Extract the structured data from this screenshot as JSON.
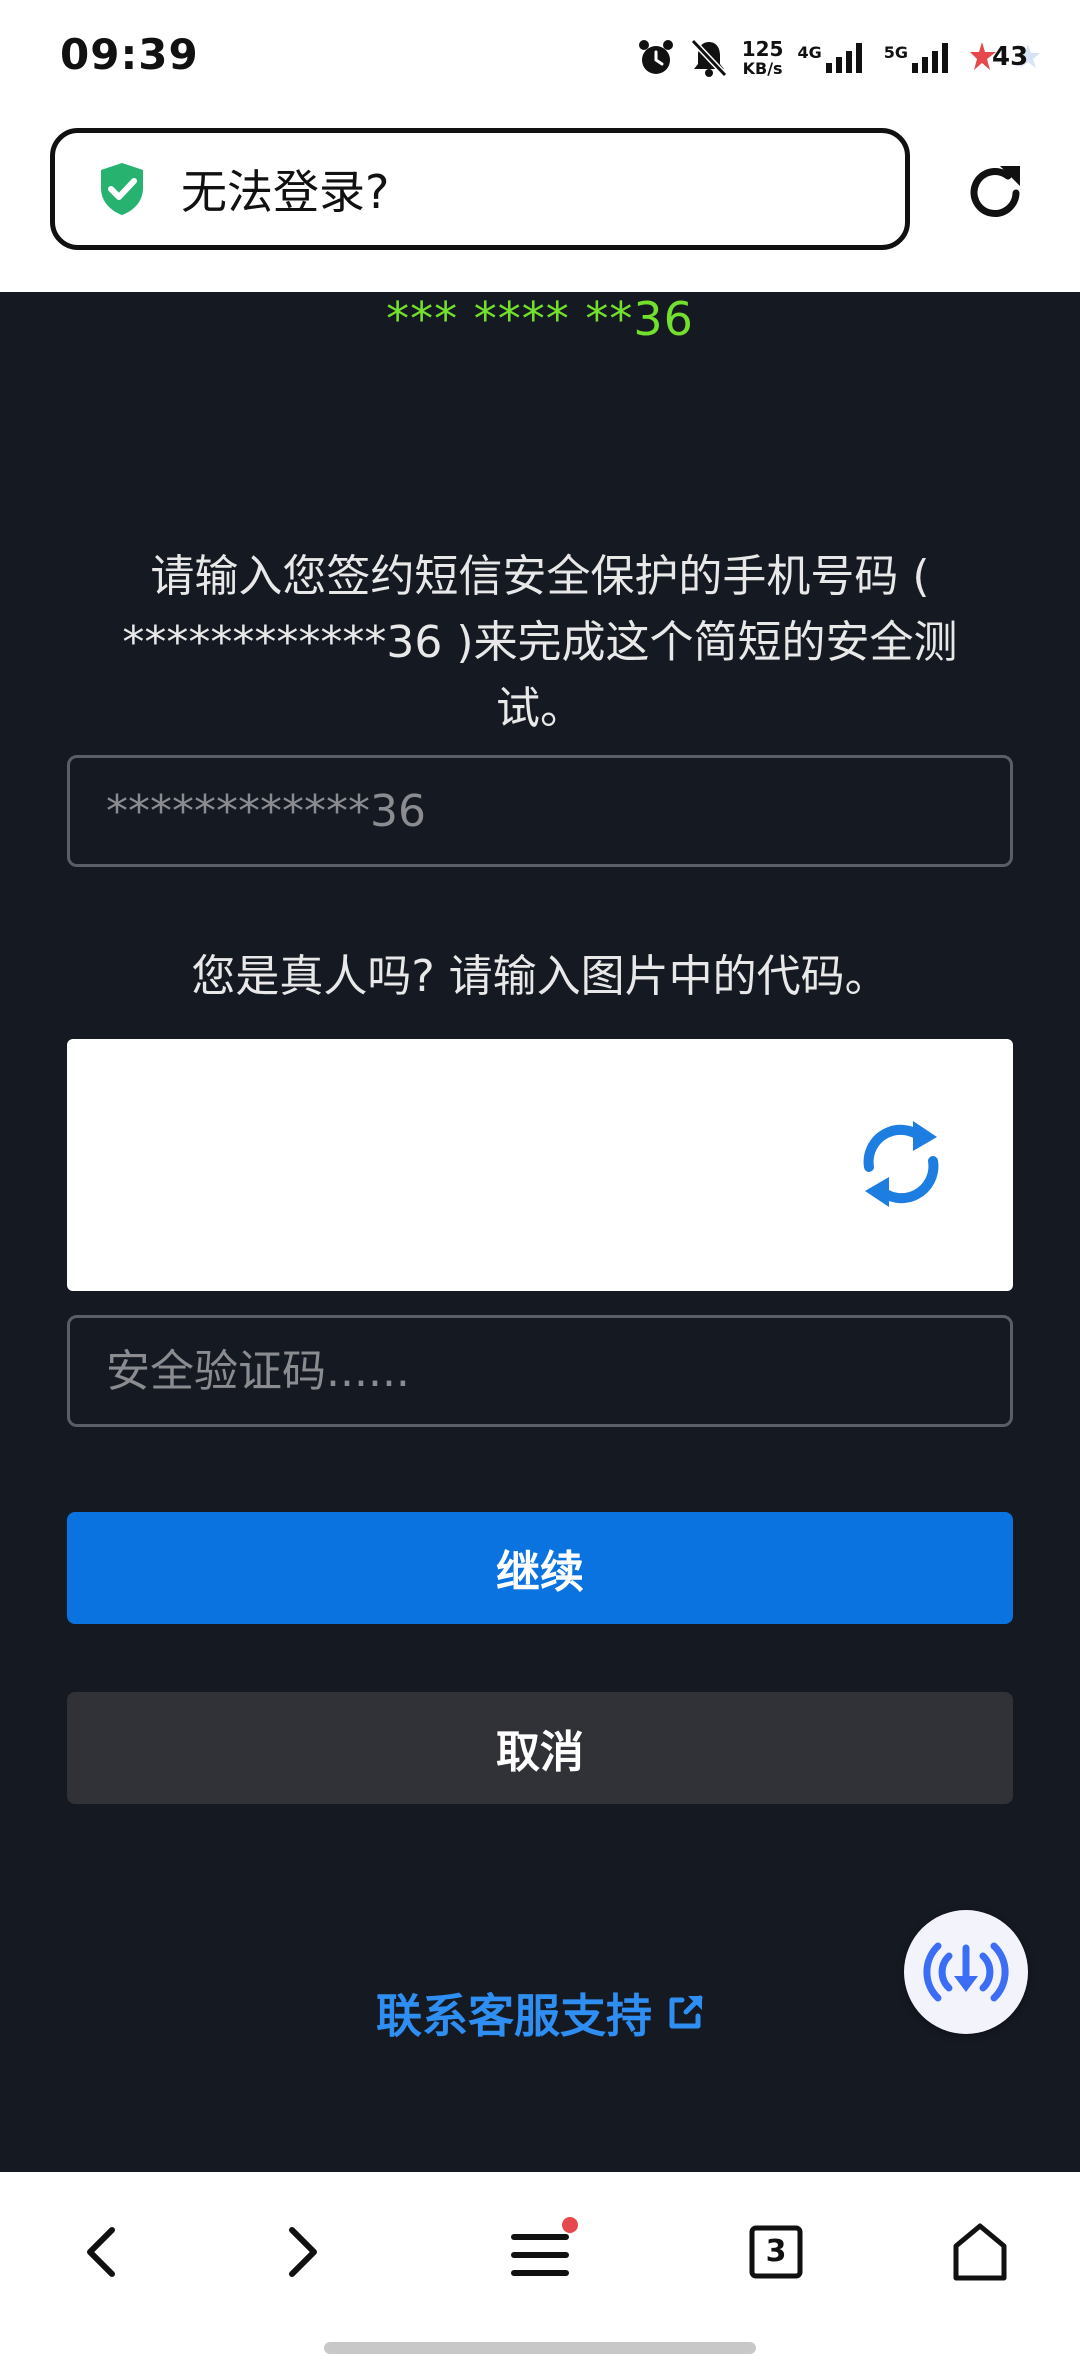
{
  "status_bar": {
    "time": "09:39",
    "net_speed_value": "125",
    "net_speed_unit": "KB/s",
    "signal_1_label": "4G",
    "signal_2_label": "5G",
    "battery_level": "43",
    "icons": [
      "alarm-icon",
      "mute-bell-icon",
      "signal-icon",
      "battery-icon"
    ]
  },
  "url_bar": {
    "title": "无法登录?",
    "security_icon": "green-shield-check-icon",
    "reload_icon": "reload-icon"
  },
  "page": {
    "masked_number_top": "*** **** **36",
    "instruction": "请输入您签约短信安全保护的手机号码 ( ************36 )来完成这个简短的安全测试。",
    "phone_placeholder": "************36",
    "captcha_label": "您是真人吗? 请输入图片中的代码。",
    "captcha_refresh_icon": "refresh-icon",
    "code_placeholder": "安全验证码......",
    "continue_label": "继续",
    "cancel_label": "取消",
    "support_link_label": "联系客服支持",
    "support_link_icon": "external-link-icon",
    "fab_icon": "download-broadcast-icon"
  },
  "bottom_nav": {
    "tabs_count": "3",
    "icons": [
      "back-icon",
      "forward-icon",
      "menu-icon",
      "tabs-icon",
      "home-icon"
    ]
  },
  "colors": {
    "page_background": "#151922",
    "accent_green": "#72e02c",
    "primary_button": "#0b73e0",
    "secondary_button": "#303237",
    "link": "#2f8ef2",
    "shield": "#27b36f"
  }
}
